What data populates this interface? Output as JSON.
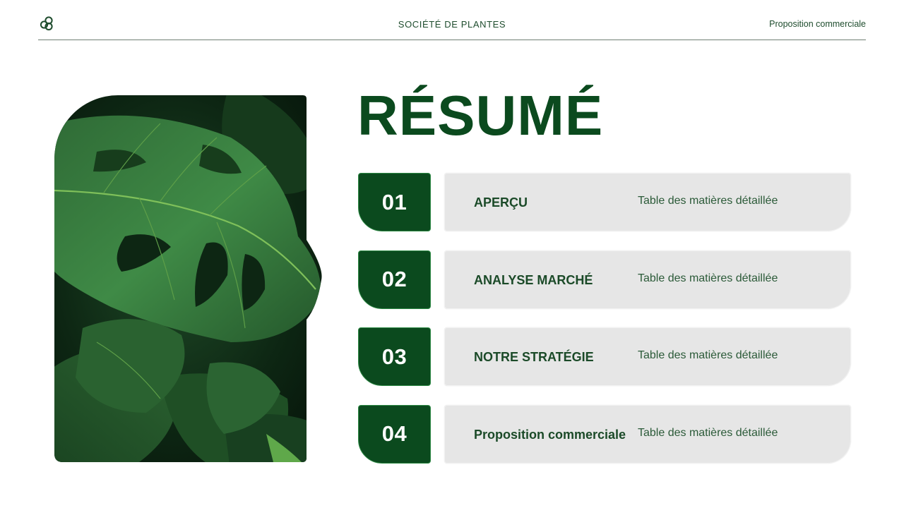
{
  "header": {
    "logo_icon": "linked-circles-icon",
    "company": "SOCIÉTÉ DE PLANTES",
    "proposal": "Proposition commerciale"
  },
  "photo": {
    "subject": "monstera-leaves-photo"
  },
  "title": "RÉSUMÉ",
  "toc": [
    {
      "number": "01",
      "title": "APERÇU",
      "subtitle": "Table des matières détaillée"
    },
    {
      "number": "02",
      "title": "ANALYSE MARCHÉ",
      "subtitle": "Table des matières détaillée"
    },
    {
      "number": "03",
      "title": "NOTRE STRATÉGIE",
      "subtitle": "Table des matières détaillée"
    },
    {
      "number": "04",
      "title": "Proposition commerciale",
      "subtitle": "Table des matières détaillée"
    }
  ],
  "colors": {
    "primary_green": "#0b4a1e",
    "accent_green": "#2e8a45",
    "item_background": "#e6e6e6",
    "text_green": "#1b4a28"
  }
}
